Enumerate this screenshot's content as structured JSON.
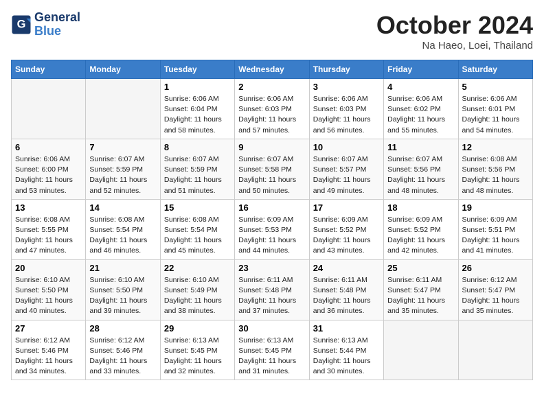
{
  "header": {
    "logo_general": "General",
    "logo_blue": "Blue",
    "month": "October 2024",
    "location": "Na Haeo, Loei, Thailand"
  },
  "weekdays": [
    "Sunday",
    "Monday",
    "Tuesday",
    "Wednesday",
    "Thursday",
    "Friday",
    "Saturday"
  ],
  "weeks": [
    [
      {
        "day": "",
        "empty": true
      },
      {
        "day": "",
        "empty": true
      },
      {
        "day": "1",
        "sunrise": "6:06 AM",
        "sunset": "6:04 PM",
        "daylight": "11 hours and 58 minutes."
      },
      {
        "day": "2",
        "sunrise": "6:06 AM",
        "sunset": "6:03 PM",
        "daylight": "11 hours and 57 minutes."
      },
      {
        "day": "3",
        "sunrise": "6:06 AM",
        "sunset": "6:03 PM",
        "daylight": "11 hours and 56 minutes."
      },
      {
        "day": "4",
        "sunrise": "6:06 AM",
        "sunset": "6:02 PM",
        "daylight": "11 hours and 55 minutes."
      },
      {
        "day": "5",
        "sunrise": "6:06 AM",
        "sunset": "6:01 PM",
        "daylight": "11 hours and 54 minutes."
      }
    ],
    [
      {
        "day": "6",
        "sunrise": "6:06 AM",
        "sunset": "6:00 PM",
        "daylight": "11 hours and 53 minutes."
      },
      {
        "day": "7",
        "sunrise": "6:07 AM",
        "sunset": "5:59 PM",
        "daylight": "11 hours and 52 minutes."
      },
      {
        "day": "8",
        "sunrise": "6:07 AM",
        "sunset": "5:59 PM",
        "daylight": "11 hours and 51 minutes."
      },
      {
        "day": "9",
        "sunrise": "6:07 AM",
        "sunset": "5:58 PM",
        "daylight": "11 hours and 50 minutes."
      },
      {
        "day": "10",
        "sunrise": "6:07 AM",
        "sunset": "5:57 PM",
        "daylight": "11 hours and 49 minutes."
      },
      {
        "day": "11",
        "sunrise": "6:07 AM",
        "sunset": "5:56 PM",
        "daylight": "11 hours and 48 minutes."
      },
      {
        "day": "12",
        "sunrise": "6:08 AM",
        "sunset": "5:56 PM",
        "daylight": "11 hours and 48 minutes."
      }
    ],
    [
      {
        "day": "13",
        "sunrise": "6:08 AM",
        "sunset": "5:55 PM",
        "daylight": "11 hours and 47 minutes."
      },
      {
        "day": "14",
        "sunrise": "6:08 AM",
        "sunset": "5:54 PM",
        "daylight": "11 hours and 46 minutes."
      },
      {
        "day": "15",
        "sunrise": "6:08 AM",
        "sunset": "5:54 PM",
        "daylight": "11 hours and 45 minutes."
      },
      {
        "day": "16",
        "sunrise": "6:09 AM",
        "sunset": "5:53 PM",
        "daylight": "11 hours and 44 minutes."
      },
      {
        "day": "17",
        "sunrise": "6:09 AM",
        "sunset": "5:52 PM",
        "daylight": "11 hours and 43 minutes."
      },
      {
        "day": "18",
        "sunrise": "6:09 AM",
        "sunset": "5:52 PM",
        "daylight": "11 hours and 42 minutes."
      },
      {
        "day": "19",
        "sunrise": "6:09 AM",
        "sunset": "5:51 PM",
        "daylight": "11 hours and 41 minutes."
      }
    ],
    [
      {
        "day": "20",
        "sunrise": "6:10 AM",
        "sunset": "5:50 PM",
        "daylight": "11 hours and 40 minutes."
      },
      {
        "day": "21",
        "sunrise": "6:10 AM",
        "sunset": "5:50 PM",
        "daylight": "11 hours and 39 minutes."
      },
      {
        "day": "22",
        "sunrise": "6:10 AM",
        "sunset": "5:49 PM",
        "daylight": "11 hours and 38 minutes."
      },
      {
        "day": "23",
        "sunrise": "6:11 AM",
        "sunset": "5:48 PM",
        "daylight": "11 hours and 37 minutes."
      },
      {
        "day": "24",
        "sunrise": "6:11 AM",
        "sunset": "5:48 PM",
        "daylight": "11 hours and 36 minutes."
      },
      {
        "day": "25",
        "sunrise": "6:11 AM",
        "sunset": "5:47 PM",
        "daylight": "11 hours and 35 minutes."
      },
      {
        "day": "26",
        "sunrise": "6:12 AM",
        "sunset": "5:47 PM",
        "daylight": "11 hours and 35 minutes."
      }
    ],
    [
      {
        "day": "27",
        "sunrise": "6:12 AM",
        "sunset": "5:46 PM",
        "daylight": "11 hours and 34 minutes."
      },
      {
        "day": "28",
        "sunrise": "6:12 AM",
        "sunset": "5:46 PM",
        "daylight": "11 hours and 33 minutes."
      },
      {
        "day": "29",
        "sunrise": "6:13 AM",
        "sunset": "5:45 PM",
        "daylight": "11 hours and 32 minutes."
      },
      {
        "day": "30",
        "sunrise": "6:13 AM",
        "sunset": "5:45 PM",
        "daylight": "11 hours and 31 minutes."
      },
      {
        "day": "31",
        "sunrise": "6:13 AM",
        "sunset": "5:44 PM",
        "daylight": "11 hours and 30 minutes."
      },
      {
        "day": "",
        "empty": true
      },
      {
        "day": "",
        "empty": true
      }
    ]
  ]
}
